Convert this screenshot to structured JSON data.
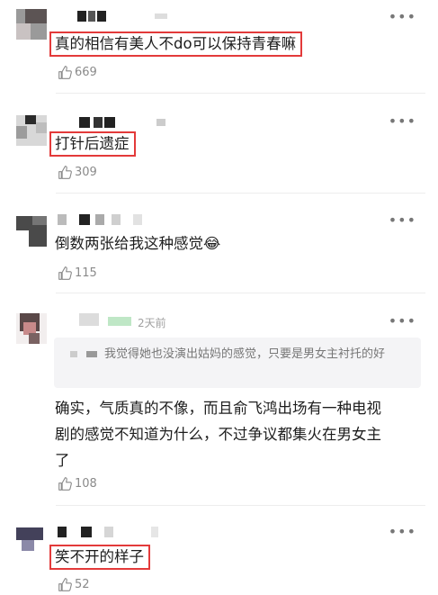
{
  "more_label": "•••",
  "comments": [
    {
      "text": "真的相信有美人不do可以保持青春嘛",
      "likes": "669"
    },
    {
      "text": "打针后遗症",
      "likes": "309"
    },
    {
      "text": "倒数两张给我这种感觉",
      "emoji": "😂",
      "likes": "115"
    },
    {
      "time": "2天前",
      "quote": "我觉得她也没演出姑妈的感觉，只要是男女主衬托的好",
      "text_lines": [
        "确实，气质真的不像，而且俞飞鸿出场有一种电视",
        "剧的感觉不知道为什么，不过争议都集火在男女主",
        "了"
      ],
      "likes": "108"
    },
    {
      "text": "笑不开的样子",
      "likes": "52"
    }
  ],
  "colors": {
    "highlight_border": "#e33a3a",
    "muted_text": "#8a8a8a",
    "quote_bg": "#f4f4f6"
  }
}
